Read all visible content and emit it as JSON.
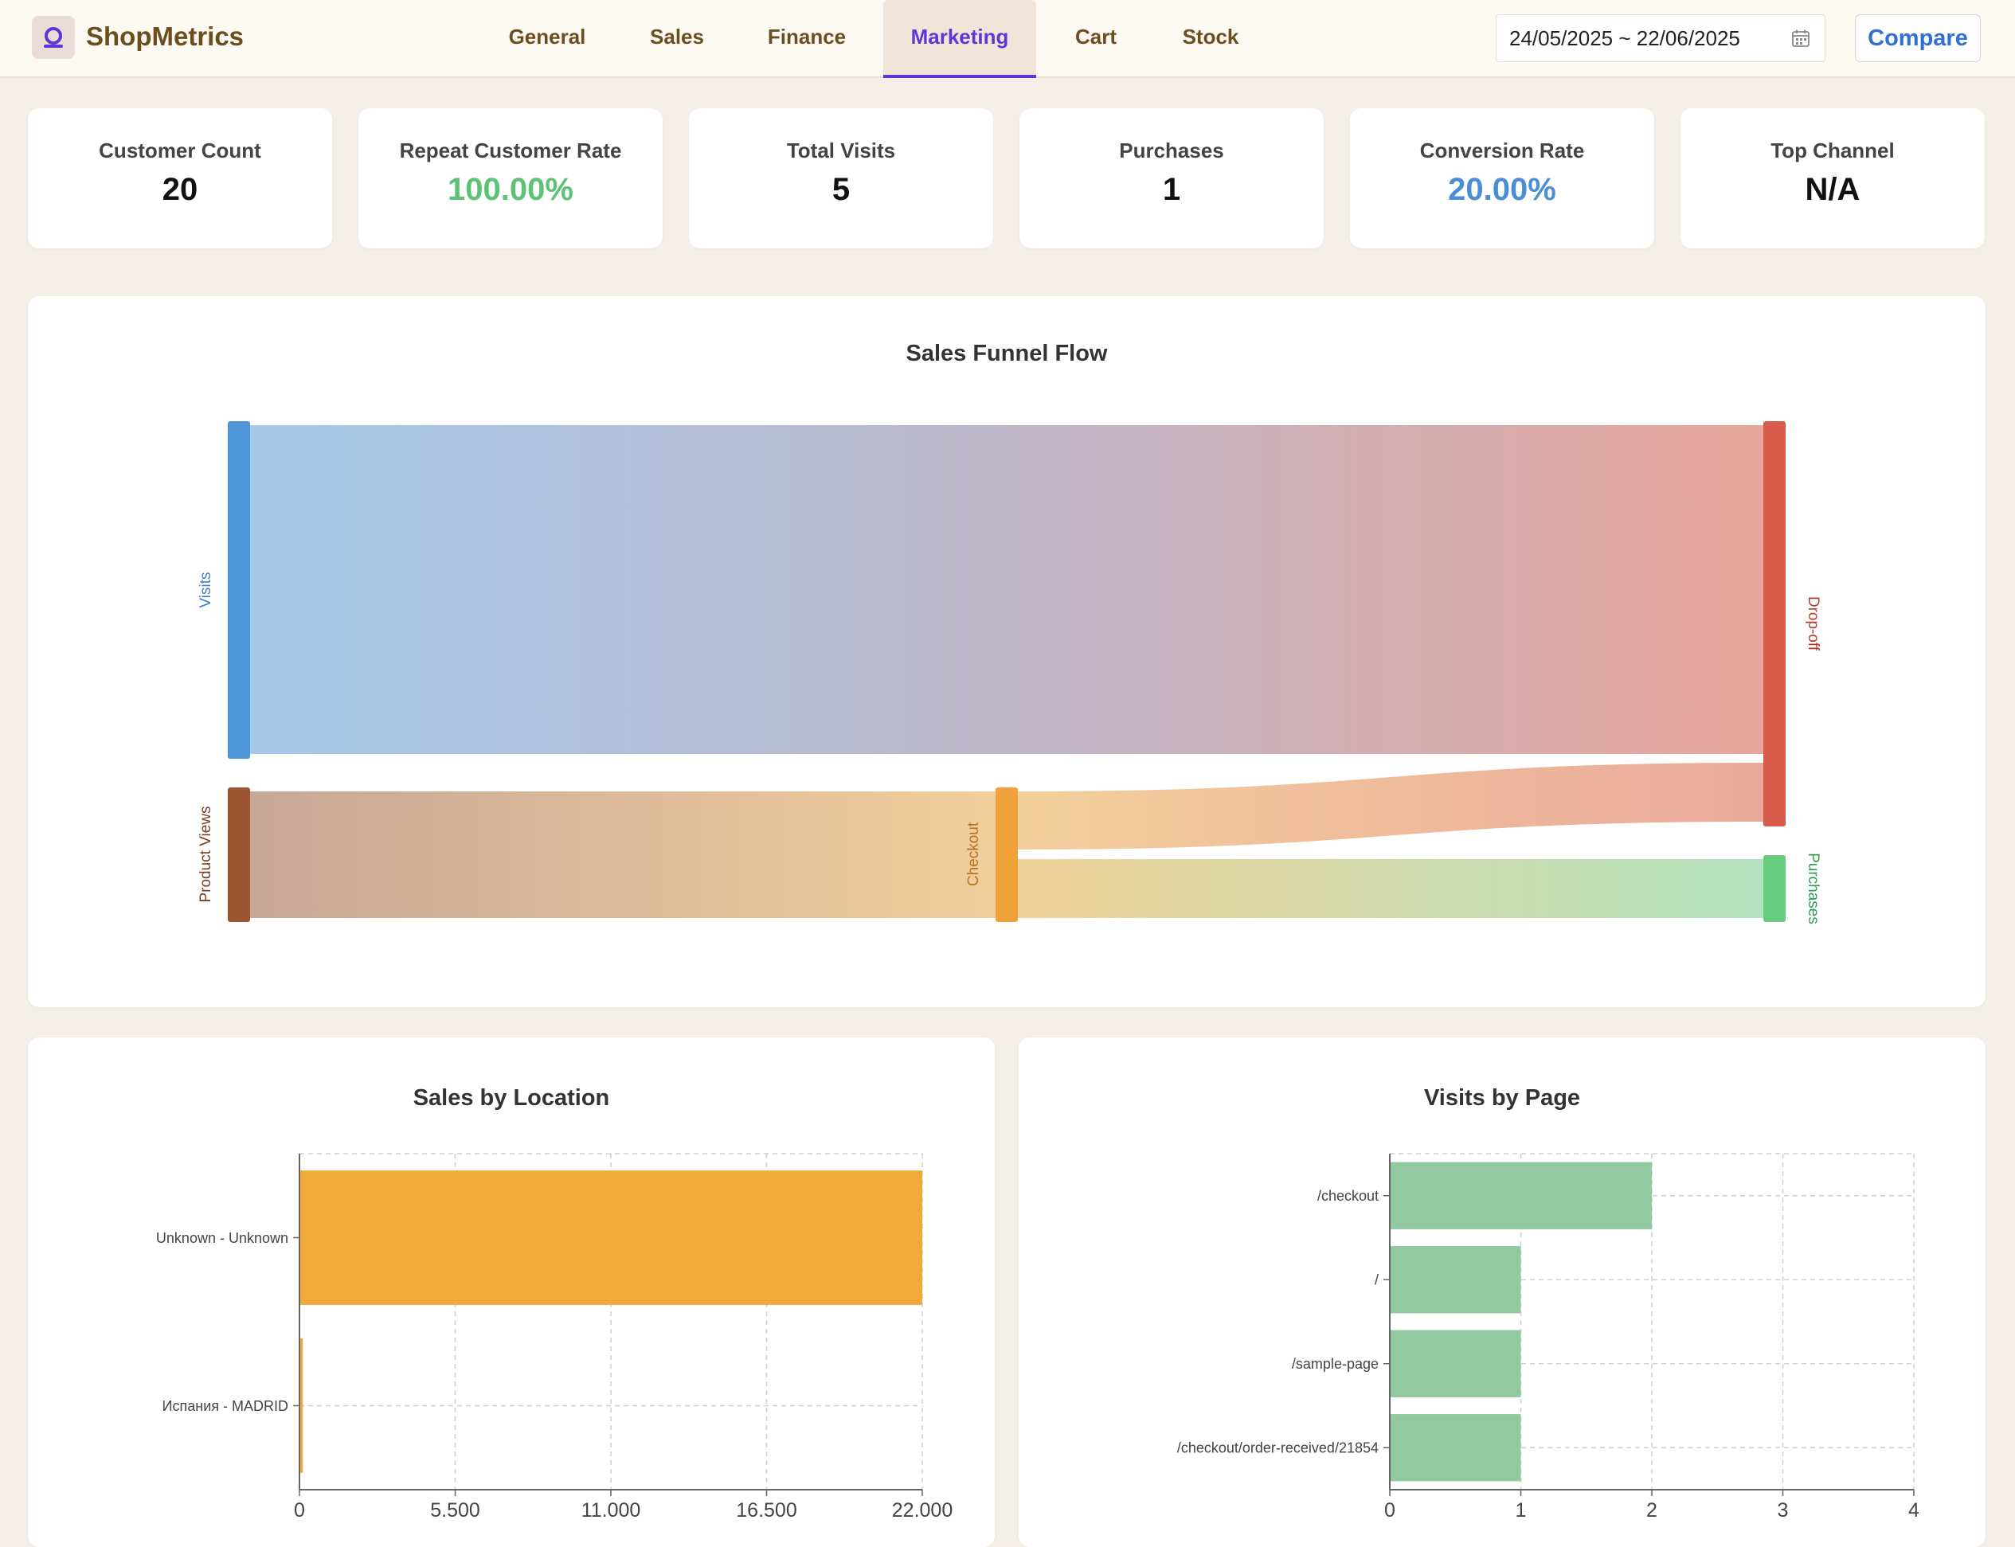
{
  "app": {
    "brand": "ShopMetrics",
    "logo_icon": "shop-logo-icon",
    "accent": "#5a38d8"
  },
  "nav": {
    "tabs": [
      {
        "label": "General",
        "active": false
      },
      {
        "label": "Sales",
        "active": false
      },
      {
        "label": "Finance",
        "active": false
      },
      {
        "label": "Marketing",
        "active": true
      },
      {
        "label": "Cart",
        "active": false
      },
      {
        "label": "Stock",
        "active": false
      }
    ]
  },
  "toolbar": {
    "date_range": "24/05/2025 ~ 22/06/2025",
    "date_icon": "calendar-icon",
    "compare_label": "Compare"
  },
  "kpis": [
    {
      "label": "Customer Count",
      "value": "20",
      "color": "#111111"
    },
    {
      "label": "Repeat Customer Rate",
      "value": "100.00%",
      "color": "#5cc274"
    },
    {
      "label": "Total Visits",
      "value": "5",
      "color": "#111111"
    },
    {
      "label": "Purchases",
      "value": "1",
      "color": "#111111"
    },
    {
      "label": "Conversion Rate",
      "value": "20.00%",
      "color": "#4a8fd6"
    },
    {
      "label": "Top Channel",
      "value": "N/A",
      "color": "#111111"
    }
  ],
  "funnel": {
    "title": "Sales Funnel Flow",
    "nodes": [
      {
        "name": "Visits",
        "color": "#4f96d8"
      },
      {
        "name": "Product Views",
        "color": "#9c5533"
      },
      {
        "name": "Checkout",
        "color": "#efa23a"
      },
      {
        "name": "Drop-off",
        "color": "#d85a4a"
      },
      {
        "name": "Purchases",
        "color": "#67cc7d"
      }
    ],
    "links": [
      {
        "source": "Visits",
        "target": "Drop-off"
      },
      {
        "source": "Product Views",
        "target": "Checkout"
      },
      {
        "source": "Checkout",
        "target": "Drop-off"
      },
      {
        "source": "Checkout",
        "target": "Purchases"
      }
    ]
  },
  "chart_data": [
    {
      "type": "bar",
      "orientation": "horizontal",
      "title": "Sales by Location",
      "categories": [
        "Unknown - Unknown",
        "Испания - MADRID"
      ],
      "values": [
        22000,
        120
      ],
      "xlim": [
        0,
        22000
      ],
      "xticks": [
        "0",
        "5.500",
        "11.000",
        "16.500",
        "22.000"
      ],
      "grid": true,
      "color": "#f0a93b"
    },
    {
      "type": "bar",
      "orientation": "horizontal",
      "title": "Visits by Page",
      "categories": [
        "/checkout",
        "/",
        "/sample-page",
        "/checkout/order-received/21854"
      ],
      "values": [
        2,
        1,
        1,
        1
      ],
      "xlim": [
        0,
        4
      ],
      "xticks": [
        "0",
        "1",
        "2",
        "3",
        "4"
      ],
      "grid": true,
      "color": "#93c9a0"
    }
  ]
}
